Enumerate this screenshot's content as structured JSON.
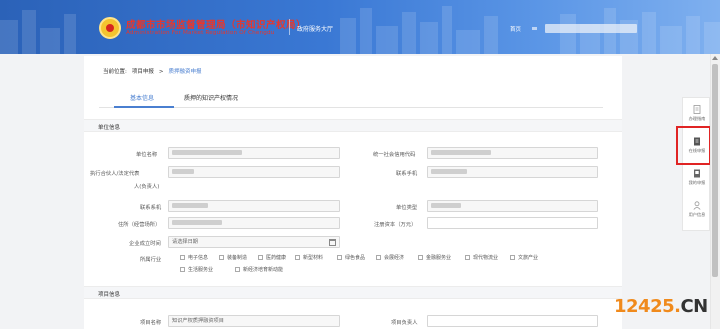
{
  "header": {
    "title": "成都市市场监督管理局（市知识产权局）",
    "subtitle": "Administration For Market Regulation Of Chengdu",
    "hall": "政府服务大厅",
    "home": "首页"
  },
  "breadcrumb": {
    "prefix": "当前位置:",
    "level1": "项目申报",
    "sep": ">",
    "current": "质押融资申报"
  },
  "tabs": [
    {
      "label": "基本信息",
      "active": true
    },
    {
      "label": "质押的知识产权情况",
      "active": false
    }
  ],
  "unit_section": {
    "title": "单位信息",
    "fields": {
      "unit_name": "单位名称",
      "credit_code": "统一社会信用代码",
      "legal_rep_line1": "执行合伙人/法定代表",
      "legal_rep_line2": "人(负责人)",
      "contact_phone": "联系手机",
      "contact_person": "联系系机",
      "unit_type": "单位类型",
      "address": "住所（经营场所）",
      "reg_capital": "注册资本（万元）",
      "founded_date": "企业成立时间",
      "founded_placeholder": "请选择日期",
      "industry": "所属行业"
    },
    "industries_row1": [
      "电子信息",
      "装备制造",
      "医药健康",
      "新型材料",
      "绿色食品",
      "会展经济",
      "金融服务业",
      "现代物流业",
      "文旅产业"
    ],
    "industries_row2": [
      "生活服务业",
      "新经济培育新动能"
    ]
  },
  "project_section": {
    "title": "项目信息",
    "project_name_label": "项目名称",
    "project_name_value": "知识产权质押融资项目",
    "project_lead_label": "项目负责人"
  },
  "side_toolbar": [
    {
      "label": "办理指南",
      "icon": "guide-icon"
    },
    {
      "label": "在线申报",
      "icon": "online-apply-icon"
    },
    {
      "label": "我的申报",
      "icon": "my-apply-icon"
    },
    {
      "label": "用户信息",
      "icon": "user-icon"
    }
  ],
  "watermark": {
    "num": "12425",
    "dot": ".",
    "cn": "CN"
  },
  "colors": {
    "accent": "#4a7fd0",
    "header": "#3a78d4",
    "logo_red": "#e8362c",
    "highlight": "#e02424",
    "watermark": "#f08a1c"
  }
}
